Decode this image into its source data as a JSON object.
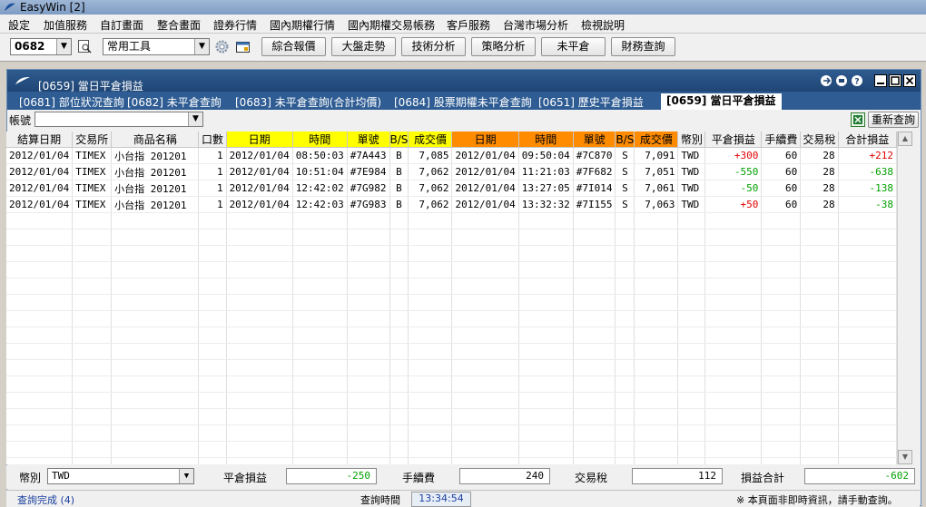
{
  "app": {
    "title": "EasyWin  [2]"
  },
  "menu": [
    "設定",
    "加值服務",
    "自訂畫面",
    "整合畫面",
    "證券行情",
    "國內期權行情",
    "國內期權交易帳務",
    "客戶服務",
    "台灣市場分析",
    "檢視說明"
  ],
  "toolbar": {
    "code_value": "0682",
    "tools_value": "常用工具",
    "buttons": [
      "綜合報價",
      "大盤走勢",
      "技術分析",
      "策略分析",
      "未平倉",
      "財務查詢"
    ]
  },
  "window": {
    "title": "[0659] 當日平倉損益"
  },
  "tabs": [
    "[0681] 部位狀況查詢",
    "[0682] 未平倉查詢",
    "[0683] 未平倉查詢(合計均價)",
    "[0684] 股票期權未平倉查詢",
    "[0651] 歷史平倉損益",
    "[0659] 當日平倉損益"
  ],
  "account": {
    "label": "帳號",
    "value": "",
    "refresh_label": "重新查詢"
  },
  "table": {
    "headers": [
      "結算日期",
      "交易所",
      "商品名稱",
      "口數",
      "日期",
      "時間",
      "單號",
      "B/S",
      "成交價",
      "日期",
      "時間",
      "單號",
      "B/S",
      "成交價",
      "幣別",
      "平倉損益",
      "手續費",
      "交易稅",
      "合計損益"
    ],
    "rows": [
      [
        "2012/01/04",
        "TIMEX",
        "小台指 201201",
        "1",
        "2012/01/04",
        "08:50:03",
        "#7A443",
        "B",
        "7,085",
        "2012/01/04",
        "09:50:04",
        "#7C870",
        "S",
        "7,091",
        "TWD",
        "+300",
        "60",
        "28",
        "+212"
      ],
      [
        "2012/01/04",
        "TIMEX",
        "小台指 201201",
        "1",
        "2012/01/04",
        "10:51:04",
        "#7E984",
        "B",
        "7,062",
        "2012/01/04",
        "11:21:03",
        "#7F682",
        "S",
        "7,051",
        "TWD",
        "-550",
        "60",
        "28",
        "-638"
      ],
      [
        "2012/01/04",
        "TIMEX",
        "小台指 201201",
        "1",
        "2012/01/04",
        "12:42:02",
        "#7G982",
        "B",
        "7,062",
        "2012/01/04",
        "13:27:05",
        "#7I014",
        "S",
        "7,061",
        "TWD",
        "-50",
        "60",
        "28",
        "-138"
      ],
      [
        "2012/01/04",
        "TIMEX",
        "小台指 201201",
        "1",
        "2012/01/04",
        "12:42:03",
        "#7G983",
        "B",
        "7,062",
        "2012/01/04",
        "13:32:32",
        "#7I155",
        "S",
        "7,063",
        "TWD",
        "+50",
        "60",
        "28",
        "-38"
      ]
    ]
  },
  "footer": {
    "currency_label": "幣別",
    "currency_value": "TWD",
    "pl_label": "平倉損益",
    "pl_value": "-250",
    "fee_label": "手續費",
    "fee_value": "240",
    "tax_label": "交易稅",
    "tax_value": "112",
    "total_label": "損益合計",
    "total_value": "-602"
  },
  "status": {
    "left": "查詢完成 (4)",
    "time_label": "查詢時間",
    "time_value": "13:34:54",
    "right": "※ 本頁面非即時資訊，請手動查詢。"
  },
  "colors": {
    "positive": "#e00000",
    "negative": "#00a000",
    "header_open": "#ffff00",
    "header_close": "#ff8c00",
    "window_title": "#1f4575"
  }
}
